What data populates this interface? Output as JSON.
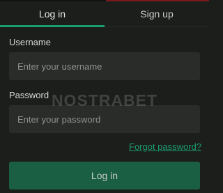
{
  "tabs": {
    "login": "Log in",
    "signup": "Sign up"
  },
  "form": {
    "username_label": "Username",
    "username_placeholder": "Enter your username",
    "password_label": "Password",
    "password_placeholder": "Enter your password",
    "forgot_link": "Forgot password?",
    "submit_label": "Log in"
  },
  "watermark": "NOSTRABET",
  "colors": {
    "accent": "#1c9c71",
    "button": "#1a5e44",
    "background": "#1c1e1c",
    "input": "#2a2c2a"
  }
}
